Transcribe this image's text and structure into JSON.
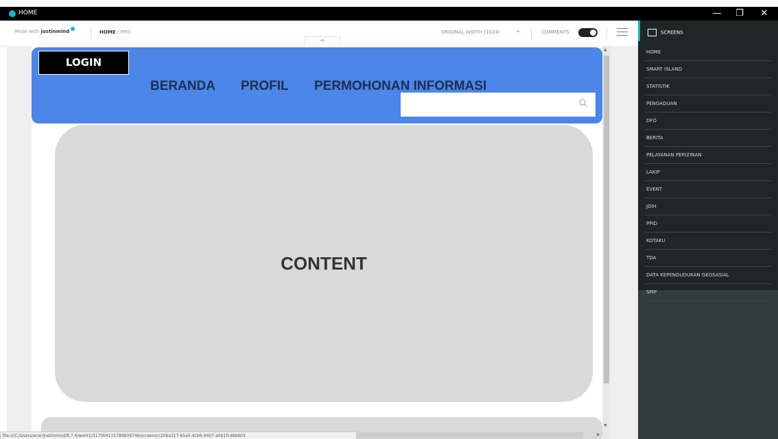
{
  "window": {
    "title": "HOME",
    "minimize": "—",
    "maximize": "❐",
    "close": "✕"
  },
  "toolbar": {
    "made_with": "Made with",
    "brand": "justinmind",
    "breadcrumb_current": "HOME",
    "breadcrumb_rest": "/ PPID",
    "width_option": "ORIGINAL WIDTH (1024)",
    "width_chevron": "⌄",
    "comments_label": "COMMENTS",
    "comments_on": true
  },
  "page": {
    "collapse_arrow": "^",
    "login_label": "LOGIN",
    "nav": [
      "BERANDA",
      "PROFIL",
      "PERMOHONAN INFORMASI"
    ],
    "search_placeholder": "",
    "content_label": "CONTENT",
    "header_color": "#4b86e8"
  },
  "sidebar": {
    "header": "SCREENS",
    "items": [
      "HOME",
      "SMART ISLAND",
      "STATISTIK",
      "PENGADUAN",
      "DFO",
      "BERITA",
      "PELAYANAN PERIZINAN",
      "LAKIP",
      "EVENT",
      "JDIH",
      "PPID",
      "KOTAKU",
      "TDA",
      "DATA KEPENDUDUKAN GEOSASIAL",
      "SPIP"
    ]
  },
  "status": {
    "url": "file:///C:/Users/acer/Justinmind/8.7.4/work1/317004115789609746/screens/c20ba317-65a5-4cb6-9407-a5b1fc4bb603"
  }
}
